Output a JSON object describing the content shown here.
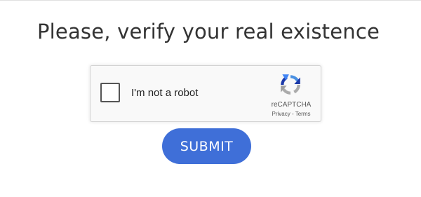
{
  "page": {
    "title": "Please, verify your real existence"
  },
  "recaptcha": {
    "checkbox_label": "I'm not a robot",
    "checked": false,
    "brand": "reCAPTCHA",
    "privacy_link": "Privacy",
    "separator": "-",
    "terms_link": "Terms"
  },
  "submit": {
    "label": "SUBMIT"
  },
  "colors": {
    "button_bg": "#3f6fd8",
    "title_text": "#333333",
    "widget_bg": "#f9f9f9",
    "widget_border": "#d3d3d3"
  },
  "icons": {
    "recaptcha_logo": "recaptcha-logo-icon"
  }
}
